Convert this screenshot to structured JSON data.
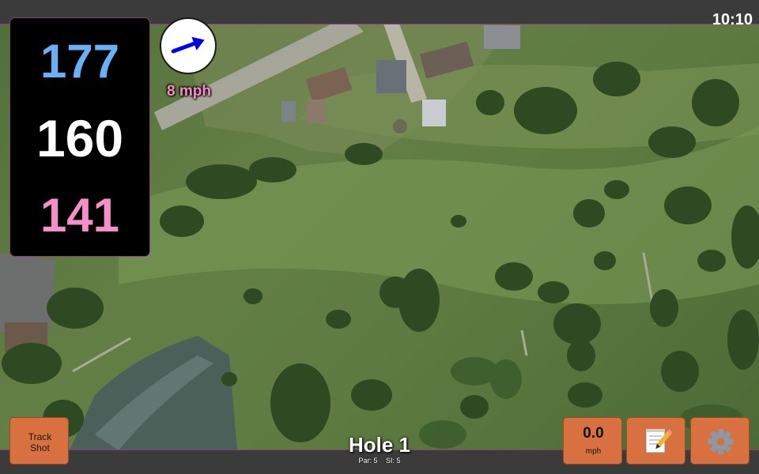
{
  "status_bar": {
    "time": "10:10"
  },
  "distances": {
    "back": "177",
    "middle": "160",
    "front": "141"
  },
  "wind": {
    "speed_label": "8 mph",
    "icon": "wind-direction-arrow-icon"
  },
  "controls": {
    "track_shot_label": "Track\nShot",
    "wind_value": "0.0",
    "wind_unit": "mph",
    "notes_icon": "notepad-icon",
    "settings_icon": "gear-icon"
  },
  "hole": {
    "title": "Hole 1",
    "par": "Par: 5",
    "si": "SI: 5"
  },
  "colors": {
    "back": "#6ab0f5",
    "middle": "#ffffff",
    "front": "#f58fc7",
    "button": "#d8703f",
    "bar": "#3b3b3b",
    "accent_line": "#8b3c7a"
  }
}
